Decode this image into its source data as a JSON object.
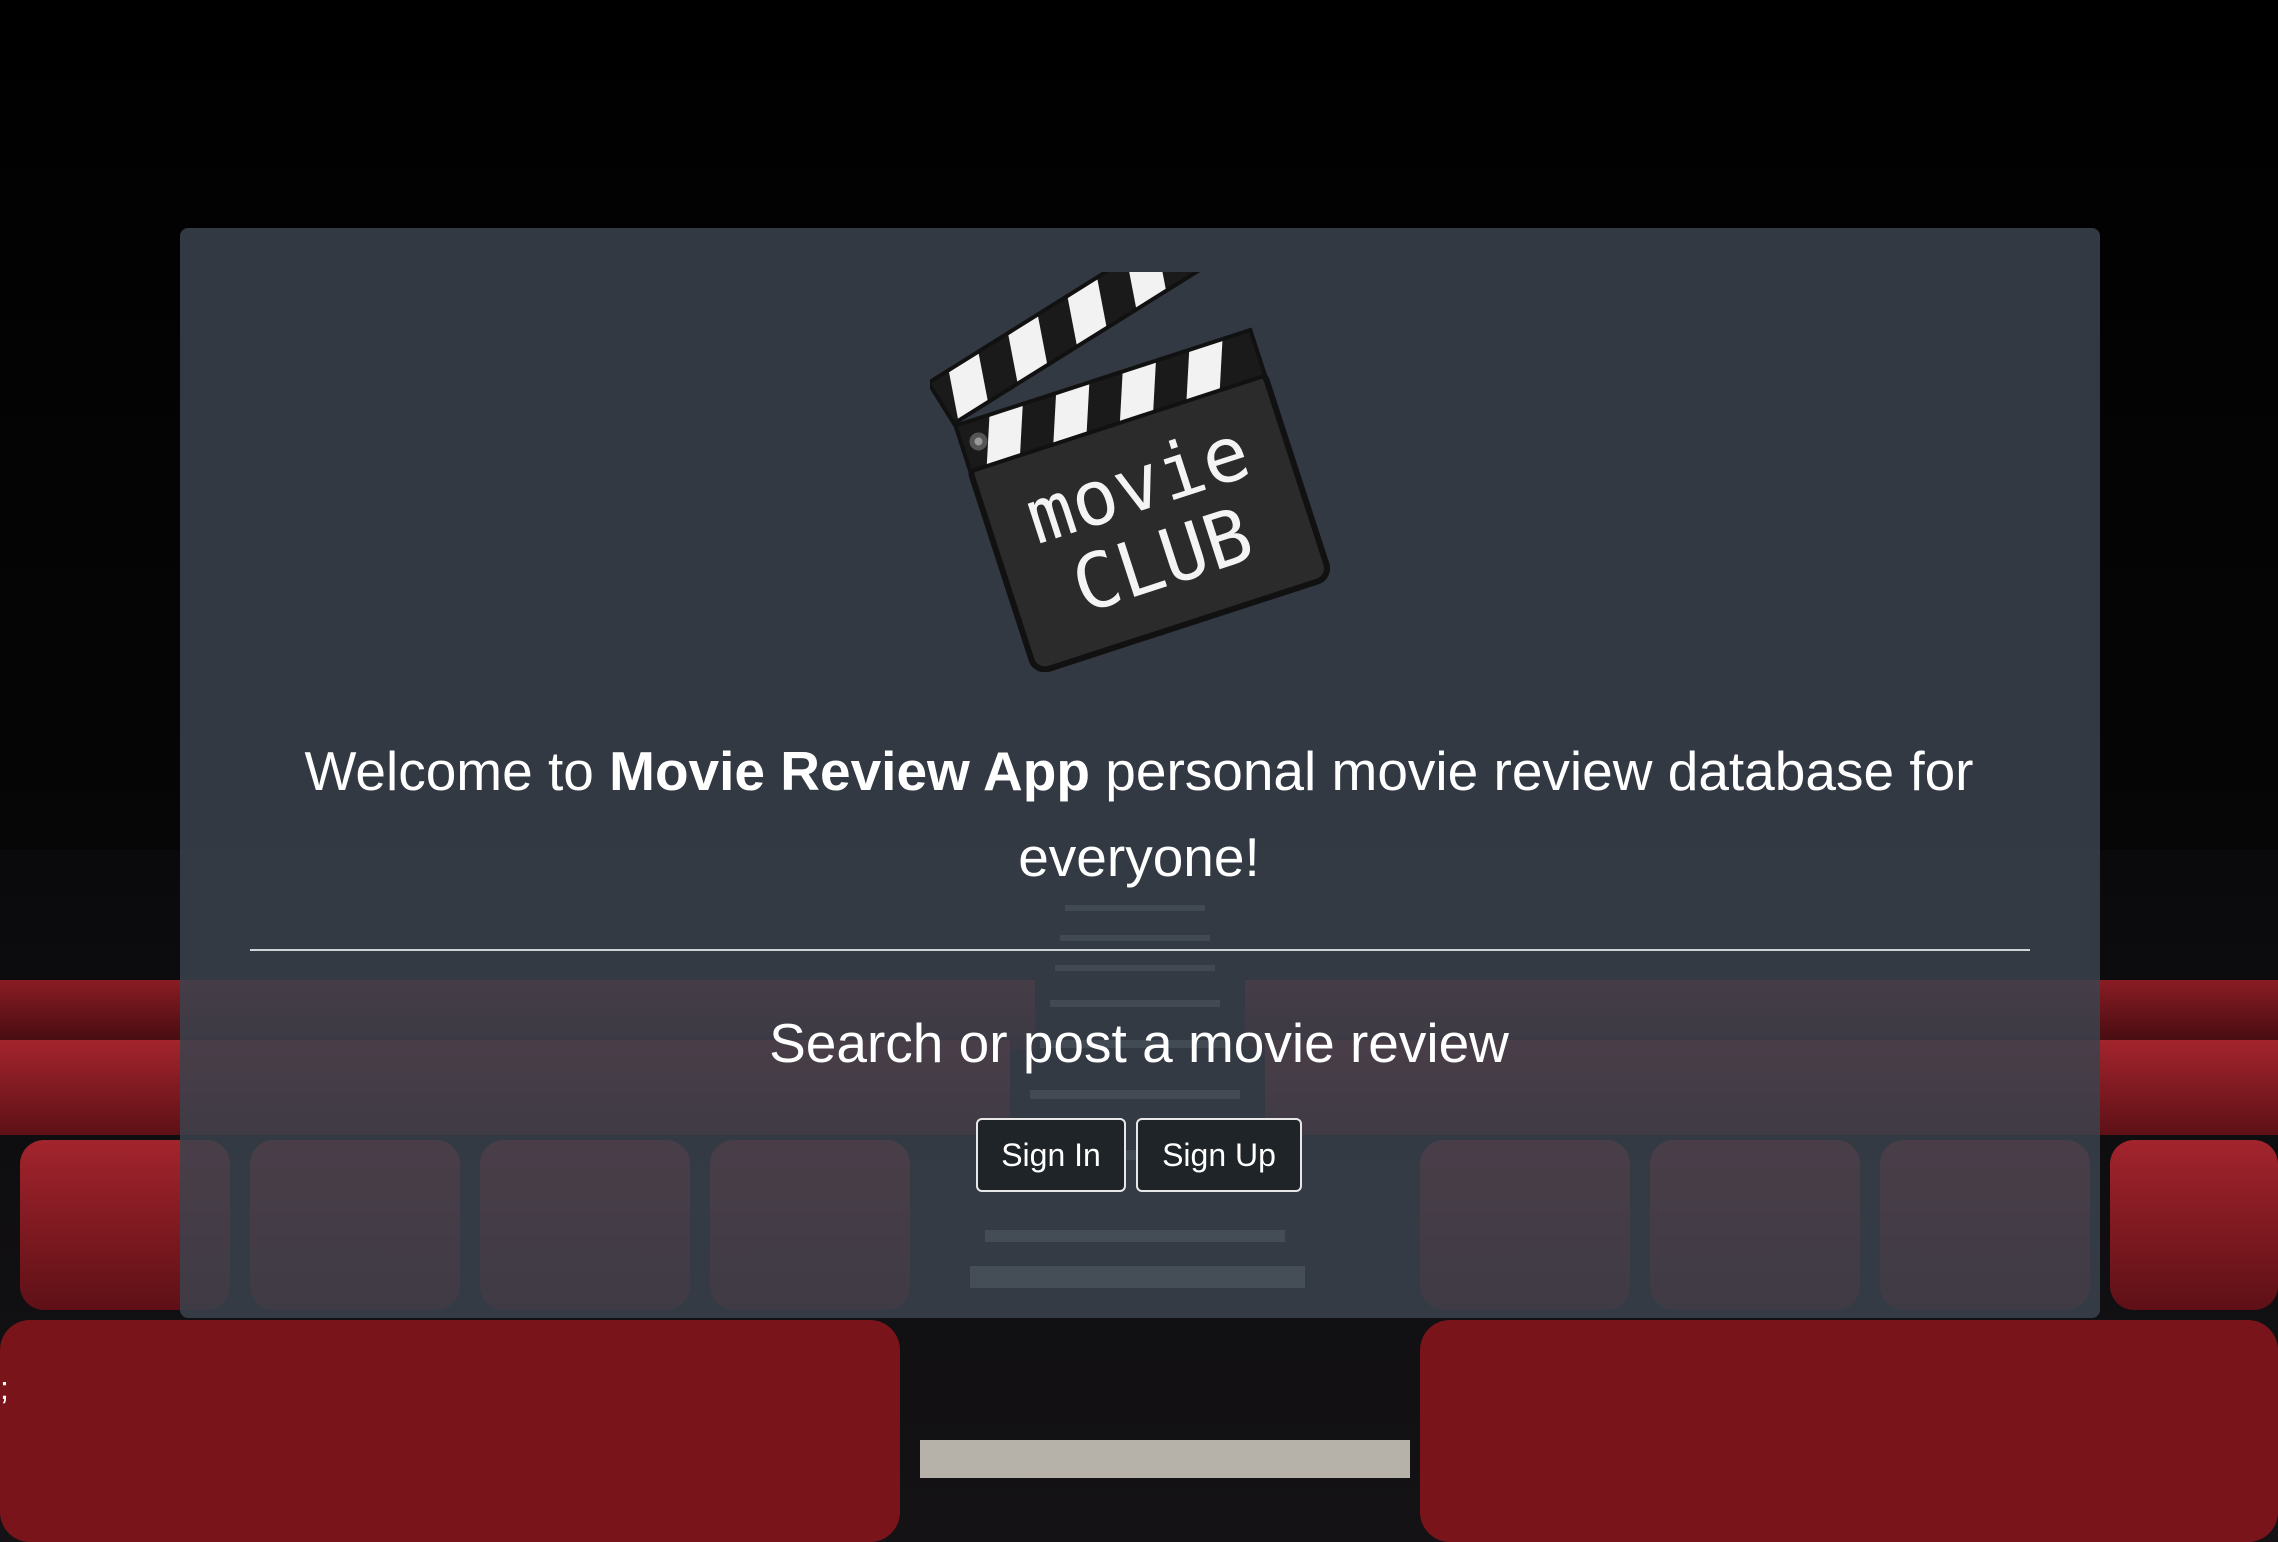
{
  "page": {
    "stray_text": ";"
  },
  "hero": {
    "logo_text": {
      "line1": "movie",
      "line2": "CLUB"
    },
    "welcome": {
      "prefix": "Welcome to ",
      "app_name": "Movie Review App",
      "suffix": " personal movie review database for everyone!"
    },
    "lead": "Search or post a movie review",
    "buttons": {
      "sign_in": "Sign In",
      "sign_up": "Sign Up"
    }
  },
  "colors": {
    "page_background": "#000000",
    "jumbotron": "#3a424d",
    "seat_red": "#8c1c24",
    "button_background": "#1e2427",
    "button_border": "#e8e8e8"
  },
  "icons": {
    "logo": "clapperboard-icon"
  }
}
